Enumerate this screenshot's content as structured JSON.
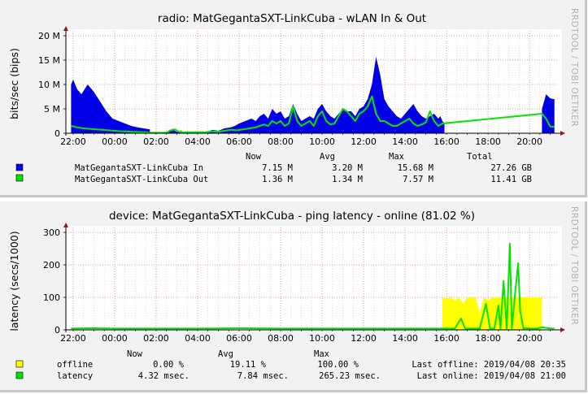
{
  "chart_data": [
    {
      "type": "area",
      "title": "radio: MatGegantaSXT-LinkCuba - wLAN In & Out",
      "ylabel": "bits/sec (bips)",
      "watermark": "RRDTOOL / TOBI OETIKER",
      "ylim": [
        0,
        20000000
      ],
      "y_ticks": [
        0,
        5000000,
        10000000,
        15000000,
        20000000
      ],
      "y_tick_labels": [
        "0",
        "5 M",
        "10 M",
        "15 M",
        "20 M"
      ],
      "x_tick_labels": [
        "22:00",
        "00:00",
        "02:00",
        "04:00",
        "06:00",
        "08:00",
        "10:00",
        "12:00",
        "14:00",
        "16:00",
        "18:00",
        "20:00"
      ],
      "grid": true,
      "legend_headers": [
        "Now",
        "Avg",
        "Max",
        "Total"
      ],
      "series": [
        {
          "name": "MatGegantaSXT-LinkCuba In",
          "color": "#0000e6",
          "style": "area",
          "now": "7.15 M",
          "avg": "3.20 M",
          "max": "15.68 M",
          "total": "27.26 GB",
          "x": [
            -2.1,
            -2.0,
            -1.8,
            -1.6,
            -1.3,
            -1.0,
            -0.7,
            -0.4,
            -0.1,
            0.2,
            0.5,
            0.8,
            1.1,
            1.4,
            1.7,
            1.7,
            2.5,
            2.6,
            2.8,
            3.0,
            3.2,
            3.3,
            4.4,
            4.5,
            4.7,
            5.0,
            5.3,
            5.6,
            5.8,
            6.0,
            6.3,
            6.6,
            6.8,
            7.0,
            7.2,
            7.4,
            7.6,
            7.8,
            8.0,
            8.2,
            8.4,
            8.6,
            8.8,
            9.0,
            9.2,
            9.4,
            9.6,
            9.8,
            10.0,
            10.2,
            10.4,
            10.6,
            10.8,
            11.0,
            11.2,
            11.4,
            11.6,
            11.8,
            12.0,
            12.2,
            12.4,
            12.6,
            12.8,
            13.0,
            13.2,
            13.4,
            13.6,
            13.8,
            14.0,
            14.2,
            14.4,
            14.6,
            14.8,
            15.0,
            15.2,
            15.4,
            15.6,
            15.7,
            15.8,
            15.9,
            15.9,
            20.6,
            20.6,
            20.8,
            21.0,
            21.2
          ],
          "y": [
            10000000,
            11000000,
            9000000,
            8000000,
            10000000,
            8500000,
            6500000,
            4500000,
            3000000,
            2500000,
            2000000,
            1500000,
            1200000,
            1000000,
            800000,
            0,
            0,
            400000,
            800000,
            300000,
            500000,
            0,
            0,
            300000,
            700000,
            500000,
            1000000,
            1200000,
            1500000,
            2000000,
            2500000,
            3000000,
            2500000,
            3500000,
            4000000,
            3000000,
            5000000,
            4000000,
            4500000,
            3000000,
            3500000,
            6000000,
            4000000,
            2500000,
            3000000,
            3500000,
            3000000,
            5000000,
            6000000,
            4500000,
            3500000,
            3000000,
            4000000,
            5000000,
            4500000,
            4500000,
            3500000,
            5000000,
            5500000,
            7000000,
            10000000,
            15680000,
            12000000,
            7000000,
            5500000,
            4500000,
            3500000,
            3000000,
            4000000,
            5000000,
            6000000,
            4500000,
            3500000,
            3000000,
            3500000,
            4000000,
            3000000,
            3500000,
            2500000,
            2000000,
            0,
            0,
            5000000,
            8000000,
            7150000,
            7000000
          ]
        },
        {
          "name": "MatGegantaSXT-LinkCuba Out",
          "color": "#00e600",
          "style": "line",
          "now": "1.36 M",
          "avg": "1.34 M",
          "max": "7.57 M",
          "total": "11.41 GB",
          "x": [
            -2.1,
            -1.8,
            -1.5,
            -1.2,
            -0.9,
            -0.6,
            -0.3,
            0.0,
            0.3,
            0.6,
            0.9,
            1.2,
            1.5,
            1.7,
            2.5,
            2.7,
            2.9,
            3.1,
            3.3,
            4.4,
            4.7,
            5.0,
            5.3,
            5.6,
            5.9,
            6.2,
            6.5,
            6.8,
            7.0,
            7.2,
            7.4,
            7.6,
            7.8,
            8.0,
            8.2,
            8.4,
            8.6,
            8.8,
            9.0,
            9.2,
            9.4,
            9.6,
            9.8,
            10.0,
            10.2,
            10.4,
            10.6,
            10.8,
            11.0,
            11.2,
            11.4,
            11.6,
            11.8,
            12.0,
            12.2,
            12.4,
            12.6,
            12.8,
            13.0,
            13.2,
            13.4,
            13.6,
            13.8,
            14.0,
            14.2,
            14.4,
            14.6,
            14.8,
            15.0,
            15.2,
            15.4,
            15.6,
            15.8,
            20.6,
            20.8,
            21.0,
            21.2
          ],
          "y": [
            1500000,
            1200000,
            1000000,
            900000,
            800000,
            700000,
            600000,
            500000,
            400000,
            350000,
            300000,
            250000,
            200000,
            100000,
            100000,
            600000,
            800000,
            300000,
            200000,
            200000,
            400000,
            300000,
            500000,
            700000,
            600000,
            800000,
            1000000,
            1200000,
            1500000,
            1800000,
            1500000,
            2500000,
            2000000,
            2500000,
            1500000,
            2000000,
            5500000,
            2500000,
            1500000,
            2000000,
            2500000,
            1500000,
            3500000,
            4500000,
            2500000,
            1800000,
            2000000,
            3500000,
            5000000,
            4500000,
            3500000,
            2500000,
            4000000,
            4500000,
            5500000,
            7570000,
            4000000,
            2500000,
            2500000,
            2000000,
            1500000,
            1500000,
            2000000,
            2500000,
            3000000,
            2000000,
            1500000,
            1800000,
            2200000,
            4500000,
            2500000,
            1500000,
            2000000,
            4000000,
            3000000,
            1360000,
            1300000
          ]
        }
      ]
    },
    {
      "type": "area",
      "title": "device: MatGegantaSXT-LinkCuba -  ping latency - online (81.02 %)",
      "ylabel": "latency (secs/1000)",
      "watermark": "RRDTOOL / TOBI OETIKER",
      "ylim": [
        0,
        300
      ],
      "y_ticks": [
        0,
        100,
        200,
        300
      ],
      "y_tick_labels": [
        "0",
        "100",
        "200",
        "300"
      ],
      "x_tick_labels": [
        "22:00",
        "00:00",
        "02:00",
        "04:00",
        "06:00",
        "08:00",
        "10:00",
        "12:00",
        "14:00",
        "16:00",
        "18:00",
        "20:00"
      ],
      "grid": true,
      "legend_headers": [
        "Now",
        "Avg",
        "Max"
      ],
      "series": [
        {
          "name": "offline",
          "color": "#ffff00",
          "style": "area",
          "now": "0.00 %",
          "avg": "19.11 %",
          "max": "100.00 %",
          "extra": "Last offline: 2019/04/08 20:35",
          "x": [
            15.8,
            15.8,
            16.0,
            16.2,
            16.4,
            16.6,
            16.8,
            17.0,
            17.2,
            17.4,
            17.6,
            17.8,
            18.0,
            18.2,
            18.4,
            18.6,
            18.8,
            19.0,
            19.2,
            19.4,
            19.6,
            19.8,
            20.0,
            20.2,
            20.4,
            20.6,
            20.6
          ],
          "y": [
            0,
            100,
            95,
            100,
            90,
            100,
            80,
            100,
            100,
            100,
            50,
            100,
            90,
            100,
            100,
            100,
            100,
            100,
            100,
            100,
            100,
            100,
            100,
            100,
            100,
            100,
            0
          ]
        },
        {
          "name": "latency",
          "color": "#00e600",
          "style": "line",
          "now": "4.32 msec.",
          "avg": "7.84 msec.",
          "max": "265.23 msec.",
          "extra": "Last online: 2019/04/08 21:00",
          "x": [
            -2.1,
            -1.0,
            0.0,
            2.0,
            4.0,
            6.0,
            8.0,
            10.0,
            12.0,
            14.0,
            15.6,
            16.4,
            16.7,
            16.9,
            17.2,
            17.6,
            17.9,
            18.1,
            18.3,
            18.5,
            18.6,
            18.75,
            18.9,
            19.05,
            19.15,
            19.3,
            19.45,
            19.55,
            19.7,
            19.85,
            20.0,
            20.4,
            20.6,
            20.8,
            21.0,
            21.2
          ],
          "y": [
            4,
            5,
            4,
            4,
            4,
            5,
            4,
            4,
            4,
            4,
            4,
            4,
            35,
            4,
            4,
            4,
            80,
            4,
            4,
            75,
            4,
            150,
            4,
            265,
            4,
            110,
            205,
            60,
            4,
            5,
            4,
            4,
            8,
            6,
            4.32,
            4
          ]
        }
      ]
    }
  ]
}
